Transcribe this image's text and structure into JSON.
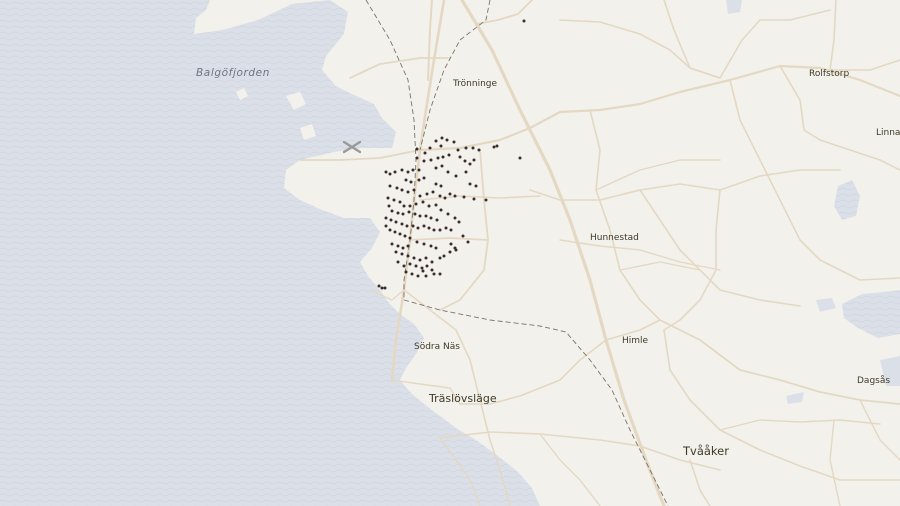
{
  "map": {
    "colors": {
      "land": "#f3f1ec",
      "water": "#dbe0e8",
      "road": "#e4d8c3",
      "railway": "#7a7468",
      "point": "#3a2b2d"
    },
    "water_labels": {
      "balgofjorden": "Balgöfjorden"
    },
    "place_labels": {
      "tronninge": "Trönninge",
      "rolfstorp": "Rolfstorp",
      "linnared": "Linnar",
      "hunnestad": "Hunnestad",
      "himle": "Himle",
      "sodra_nas": "Södra Näs",
      "traslovslage": "Träslövsläge",
      "tvaaker": "Tvååker",
      "dagsas": "Dagsås"
    },
    "icons": [
      "airport-icon"
    ]
  }
}
